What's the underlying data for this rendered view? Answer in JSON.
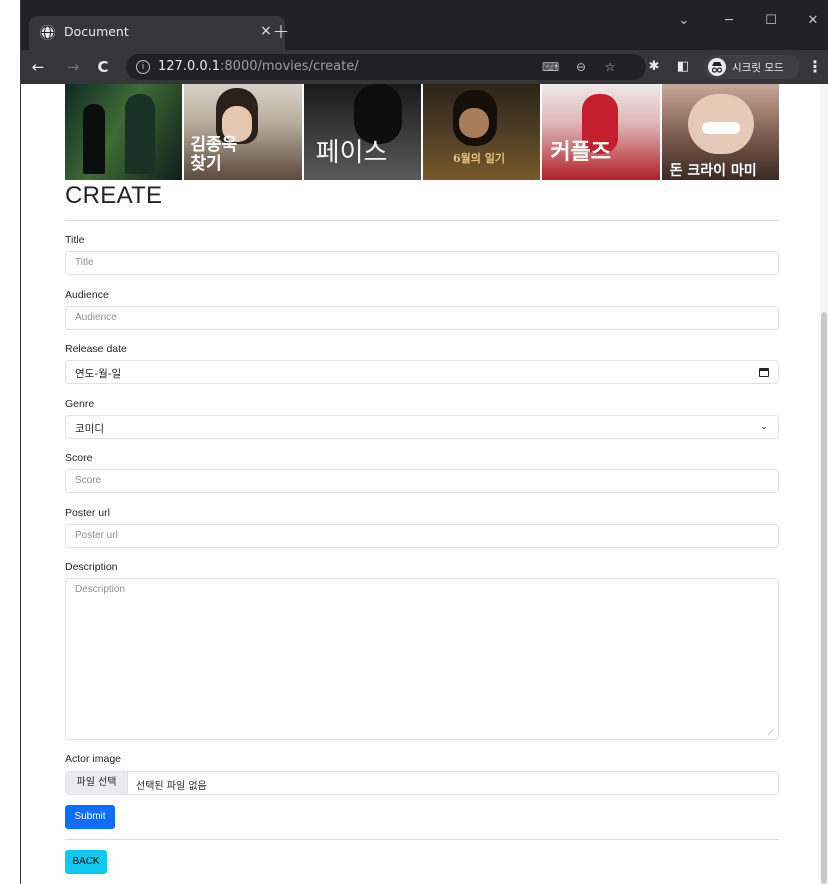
{
  "browser": {
    "tab_title": "Document",
    "tab_close": "×",
    "new_tab": "+",
    "url_host": "127.0.0.1",
    "url_path": ":8000/movies/create/",
    "incognito_label": "시크릿 모드",
    "icons": [
      "globe-icon",
      "back-arrow-icon",
      "forward-arrow-icon",
      "reload-icon",
      "info-icon",
      "translate-icon",
      "zoom-icon",
      "bookmark-star-icon",
      "extensions-icon",
      "side-panel-icon",
      "incognito-icon",
      "menu-dots-icon"
    ]
  },
  "posters": [
    {
      "id": "poster-1",
      "title": "",
      "colors": [
        "#0c2a22",
        "#3f6b35"
      ]
    },
    {
      "id": "poster-2",
      "title": "김종욱 찾기",
      "colors": [
        "#d8d3c8",
        "#5b4a3d"
      ]
    },
    {
      "id": "poster-3",
      "title": "페이스",
      "colors": [
        "#1a1a1a",
        "#5a5a5a"
      ]
    },
    {
      "id": "poster-4",
      "title": "6월의 일기",
      "colors": [
        "#2c2418",
        "#7a5a2a"
      ]
    },
    {
      "id": "poster-5",
      "title": "커플즈",
      "colors": [
        "#efe8e8",
        "#b0202a"
      ]
    },
    {
      "id": "poster-6",
      "title": "돈 크라이 마미",
      "colors": [
        "#3a2a24",
        "#c9a89a"
      ]
    }
  ],
  "form": {
    "heading": "CREATE",
    "title_label": "Title",
    "title_placeholder": "Title",
    "audience_label": "Audience",
    "audience_placeholder": "Audience",
    "release_label": "Release date",
    "release_value": "연도-월-일",
    "genre_label": "Genre",
    "genre_value": "코미디",
    "score_label": "Score",
    "score_placeholder": "Score",
    "poster_label": "Poster url",
    "poster_placeholder": "Poster url",
    "description_label": "Description",
    "description_placeholder": "Description",
    "actor_label": "Actor image",
    "file_button": "파일 선택",
    "file_status": "선택된 파일 없음",
    "submit": "Submit",
    "back": "BACK"
  },
  "colors": {
    "primary": "#0d6efd",
    "info": "#0dcaf0",
    "chrome_dark": "#202124",
    "chrome_toolbar": "#35363a"
  }
}
